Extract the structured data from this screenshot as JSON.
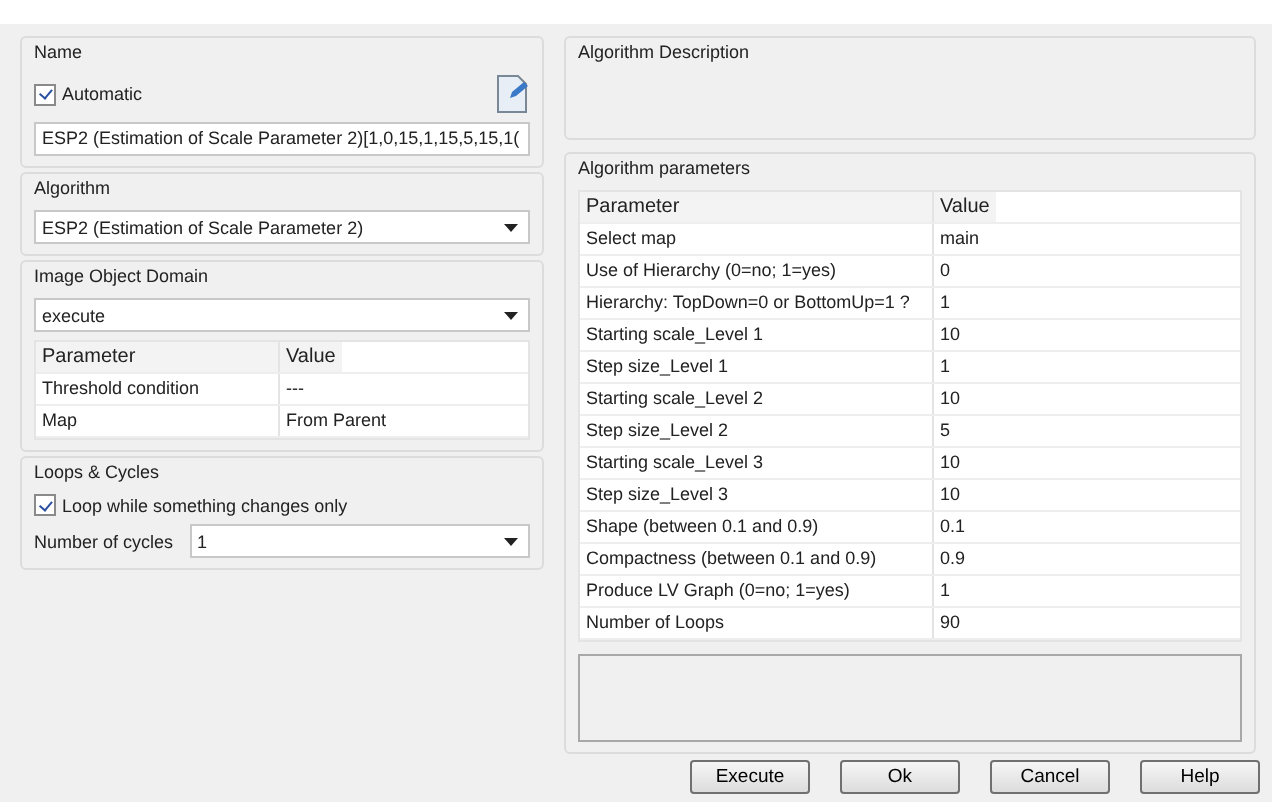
{
  "name": {
    "label": "Name",
    "automatic": {
      "label": "Automatic",
      "checked": true
    },
    "value": "ESP2 (Estimation of Scale Parameter 2)[1,0,15,1,15,5,15,1("
  },
  "algorithm": {
    "label": "Algorithm",
    "value": "ESP2 (Estimation of Scale Parameter 2)"
  },
  "domain": {
    "label": "Image Object Domain",
    "value": "execute",
    "columns": [
      "Parameter",
      "Value"
    ],
    "rows": [
      [
        "Threshold condition",
        "---"
      ],
      [
        "Map",
        "From Parent"
      ]
    ]
  },
  "loops": {
    "label": "Loops & Cycles",
    "loop_while": {
      "label": "Loop while something changes only",
      "checked": true
    },
    "cycles_label": "Number of cycles",
    "cycles": "1"
  },
  "description": {
    "label": "Algorithm Description"
  },
  "parameters": {
    "label": "Algorithm parameters",
    "columns": [
      "Parameter",
      "Value"
    ],
    "rows": [
      [
        "Select map",
        "main"
      ],
      [
        "Use of Hierarchy (0=no; 1=yes)",
        "0"
      ],
      [
        "Hierarchy: TopDown=0 or BottomUp=1 ?",
        "1"
      ],
      [
        "Starting scale_Level 1",
        "10"
      ],
      [
        "Step size_Level 1",
        "1"
      ],
      [
        "Starting scale_Level 2",
        "10"
      ],
      [
        "Step size_Level 2",
        "5"
      ],
      [
        "Starting scale_Level 3",
        "10"
      ],
      [
        "Step size_Level 3",
        "10"
      ],
      [
        "Shape (between 0.1 and 0.9)",
        "0.1"
      ],
      [
        "Compactness (between 0.1 and 0.9)",
        "0.9"
      ],
      [
        "Produce LV Graph (0=no; 1=yes)",
        "1"
      ],
      [
        "Number of Loops",
        "90"
      ]
    ]
  },
  "buttons": [
    "Execute",
    "Ok",
    "Cancel",
    "Help"
  ]
}
